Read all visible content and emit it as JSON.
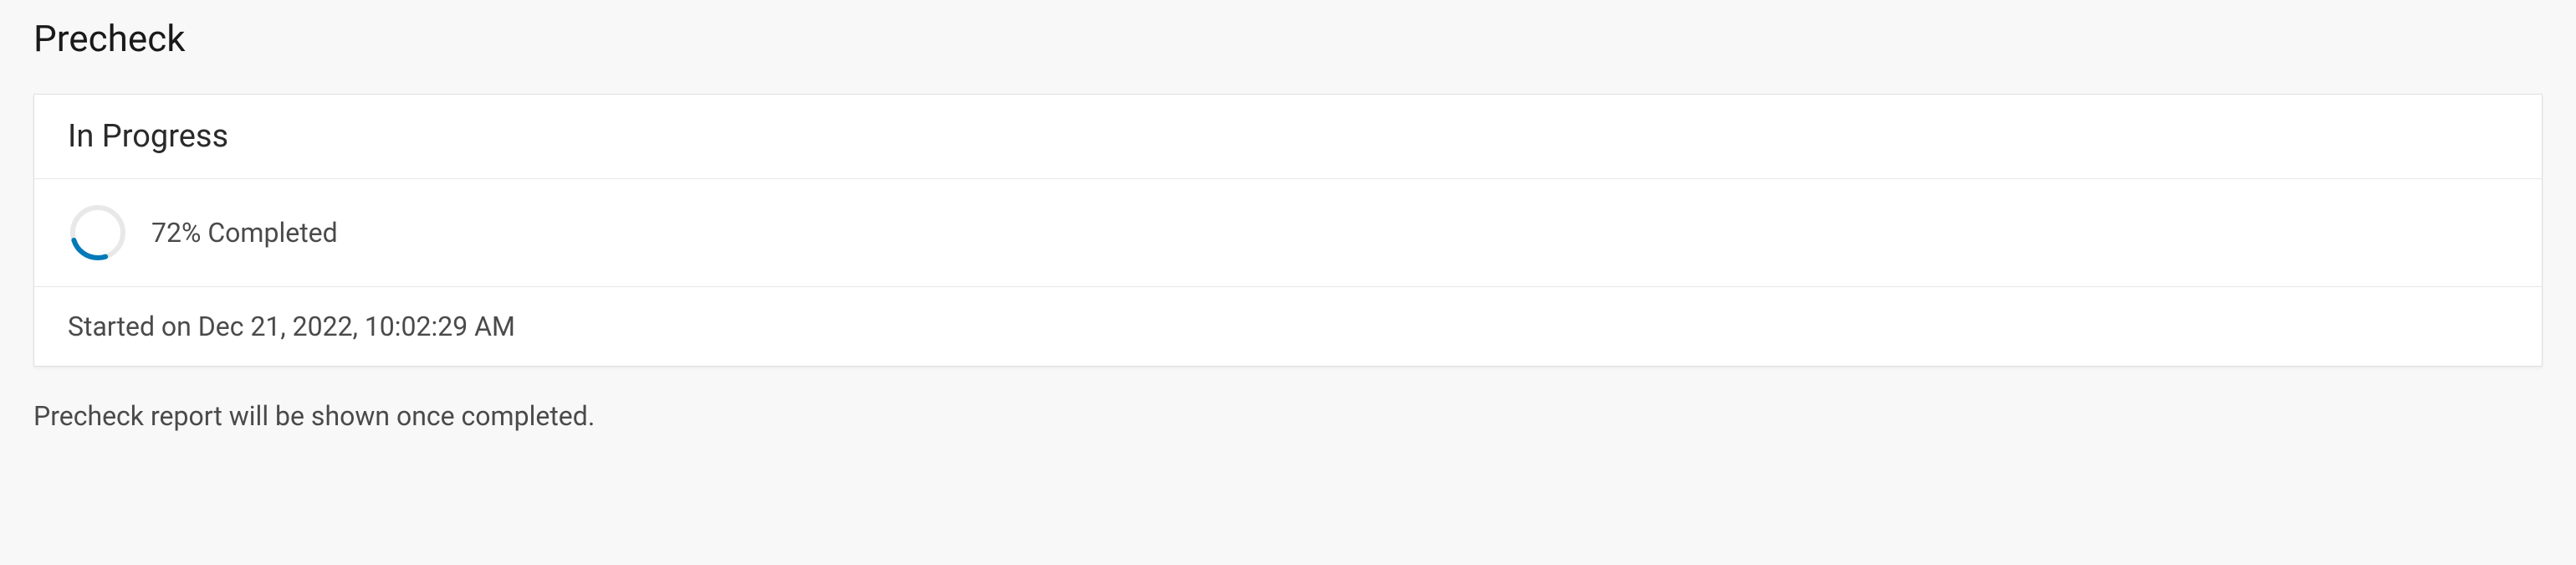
{
  "page_title": "Precheck",
  "status": {
    "title": "In Progress",
    "progress_percent": 72,
    "progress_label": "72% Completed",
    "started_label": "Started on Dec 21, 2022, 10:02:29 AM"
  },
  "footer_note": "Precheck report will be shown once completed.",
  "colors": {
    "accent": "#0079b8",
    "spinner_bg": "#e8e8e8"
  }
}
